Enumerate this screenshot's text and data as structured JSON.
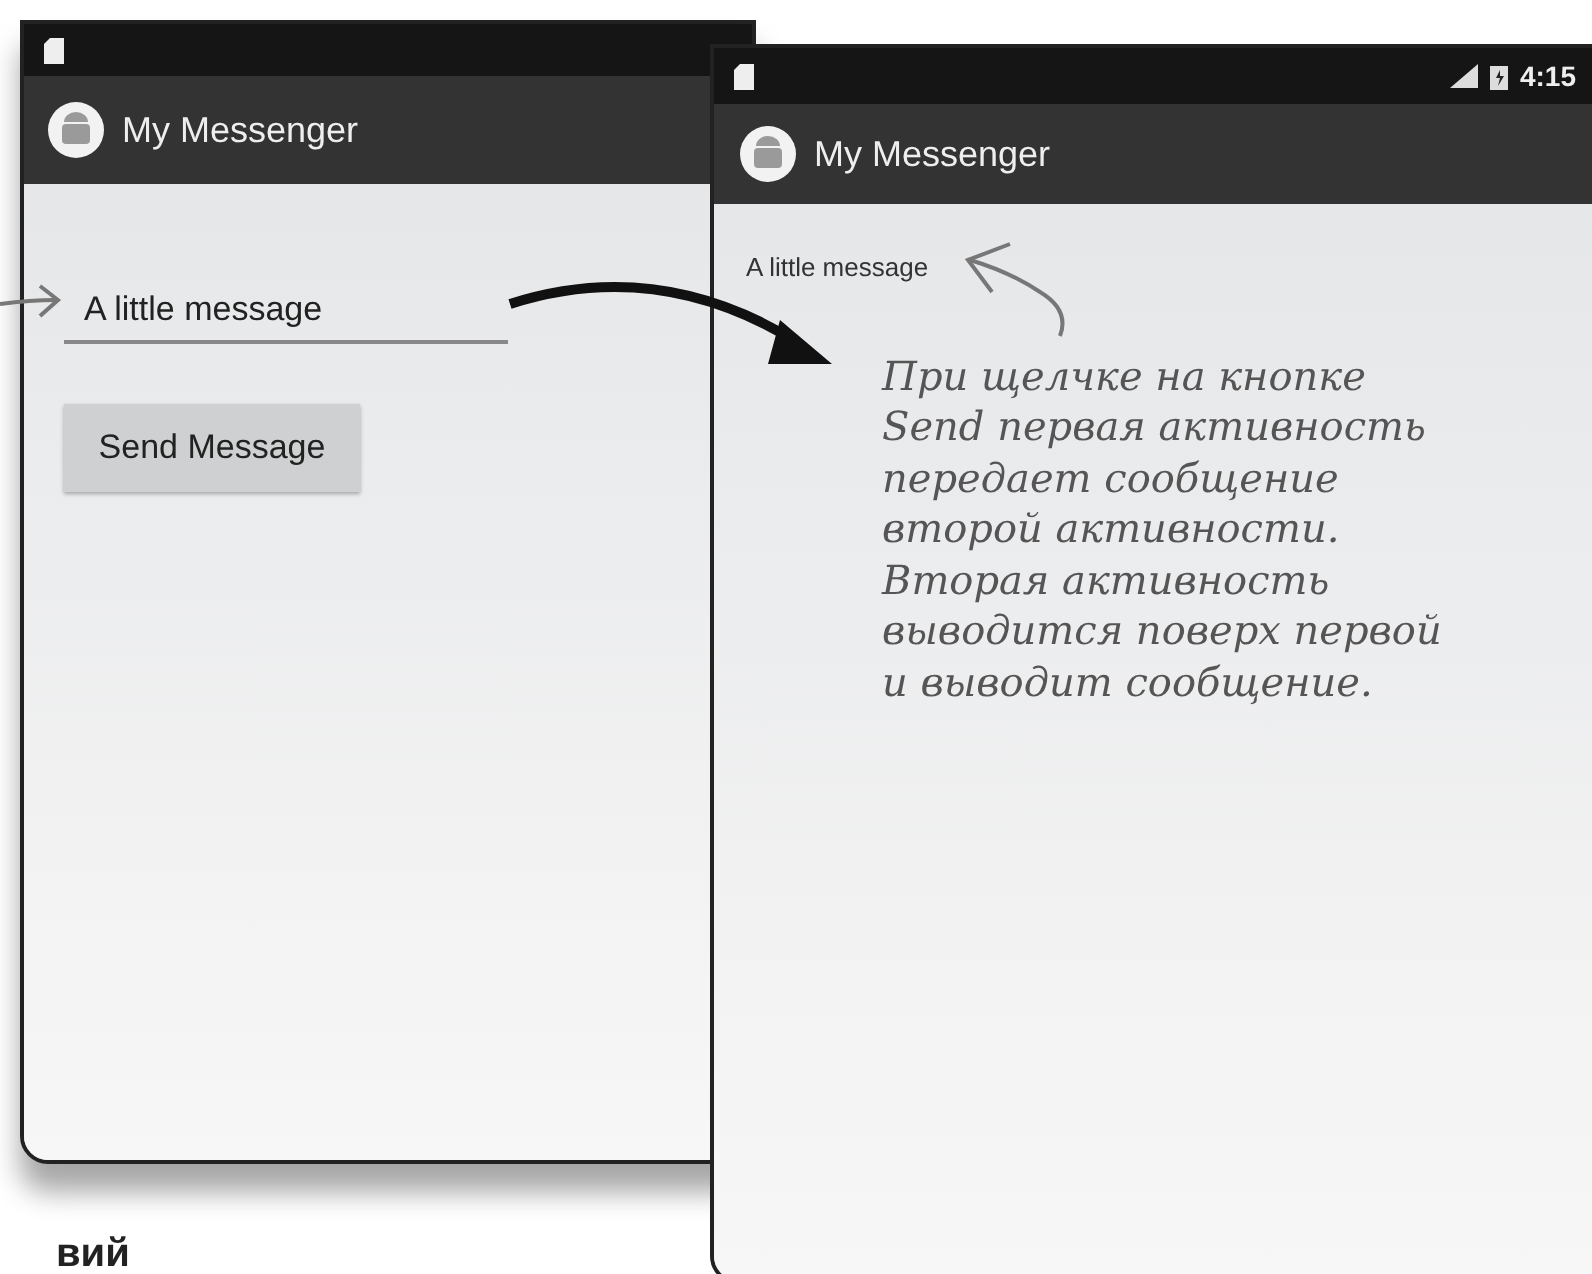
{
  "left_screen": {
    "app_title": "My Messenger",
    "message_field": {
      "value": "A little message"
    },
    "send_button": "Send Message"
  },
  "right_screen": {
    "status_time": "4:15",
    "app_title": "My Messenger",
    "received_message": "A little message"
  },
  "annotation": [
    "При щелчке на кнопке",
    "Send первая активность",
    "передает сообщение",
    "второй активности.",
    "Вторая активность",
    "выводится поверх первой",
    "и выводит сообщение."
  ],
  "caption_fragment": "вий"
}
